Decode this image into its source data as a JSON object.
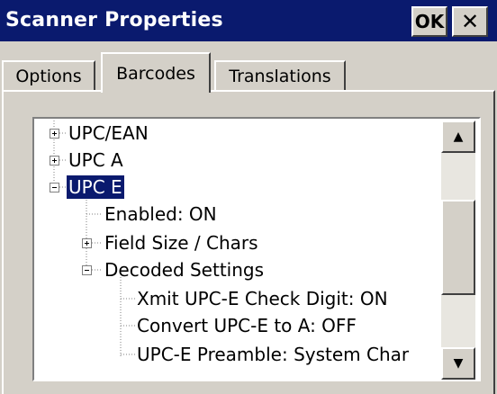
{
  "window": {
    "title": "Scanner Properties",
    "ok_label": "OK",
    "close_label": "✕"
  },
  "tabs": [
    {
      "label": "Options",
      "active": false
    },
    {
      "label": "Barcodes",
      "active": true
    },
    {
      "label": "Translations",
      "active": false
    }
  ],
  "tree": {
    "nodes": [
      {
        "label": "UPC/EAN",
        "expander": "plus"
      },
      {
        "label": "UPC A",
        "expander": "plus"
      },
      {
        "label": "UPC E",
        "expander": "minus",
        "selected": true
      },
      {
        "label": "Enabled: ON",
        "expander": "none"
      },
      {
        "label": "Field Size / Chars",
        "expander": "plus"
      },
      {
        "label": "Decoded Settings",
        "expander": "minus"
      },
      {
        "label": "Xmit UPC-E Check Digit: ON",
        "expander": "none"
      },
      {
        "label": "Convert UPC-E to A: OFF",
        "expander": "none"
      },
      {
        "label": "UPC-E Preamble: System Char",
        "expander": "none"
      }
    ]
  },
  "scrollbar": {
    "up_icon": "▲",
    "down_icon": "▼"
  },
  "colors": {
    "titlebar": "#0a1a6e",
    "selection": "#0a1a6e",
    "face": "#d4d0c8"
  }
}
